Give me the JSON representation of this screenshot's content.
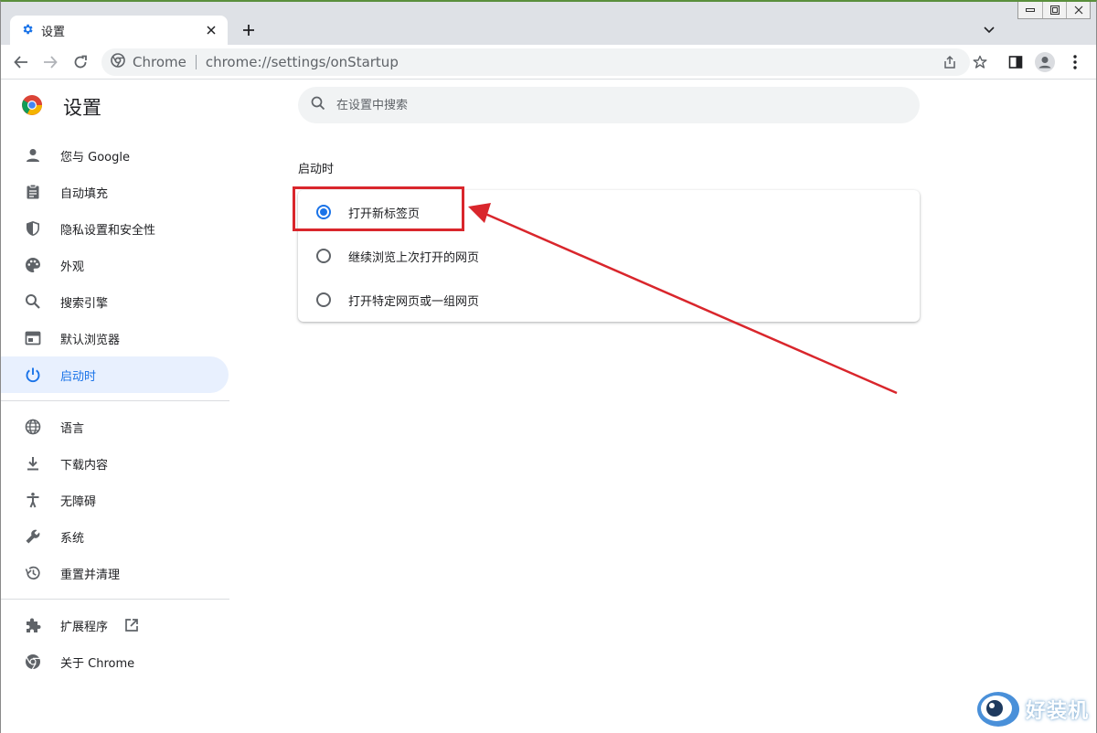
{
  "tab": {
    "title": "设置",
    "icon": "gear-icon",
    "close": "close-icon"
  },
  "toolbar": {
    "site_name": "Chrome",
    "url": "chrome://settings/onStartup"
  },
  "page": {
    "title": "设置",
    "search_placeholder": "在设置中搜索"
  },
  "sidebar": {
    "items": [
      {
        "label": "您与 Google",
        "icon": "person-icon"
      },
      {
        "label": "自动填充",
        "icon": "clipboard-icon"
      },
      {
        "label": "隐私设置和安全性",
        "icon": "shield-icon"
      },
      {
        "label": "外观",
        "icon": "palette-icon"
      },
      {
        "label": "搜索引擎",
        "icon": "search-icon"
      },
      {
        "label": "默认浏览器",
        "icon": "browser-icon"
      },
      {
        "label": "启动时",
        "icon": "power-icon",
        "active": true
      }
    ],
    "items2": [
      {
        "label": "语言",
        "icon": "globe-icon"
      },
      {
        "label": "下载内容",
        "icon": "download-icon"
      },
      {
        "label": "无障碍",
        "icon": "accessibility-icon"
      },
      {
        "label": "系统",
        "icon": "wrench-icon"
      },
      {
        "label": "重置并清理",
        "icon": "restore-icon"
      }
    ],
    "items3": [
      {
        "label": "扩展程序",
        "icon": "puzzle-icon"
      },
      {
        "label": "关于 Chrome",
        "icon": "chrome-icon"
      }
    ]
  },
  "startup": {
    "section_title": "启动时",
    "options": [
      {
        "label": "打开新标签页",
        "checked": true
      },
      {
        "label": "继续浏览上次打开的网页",
        "checked": false
      },
      {
        "label": "打开特定网页或一组网页",
        "checked": false
      }
    ]
  },
  "watermark": {
    "text": "好装机"
  },
  "colors": {
    "accent": "#1a73e8",
    "annotation": "#d9262c",
    "active_bg": "#e8f0fe"
  }
}
